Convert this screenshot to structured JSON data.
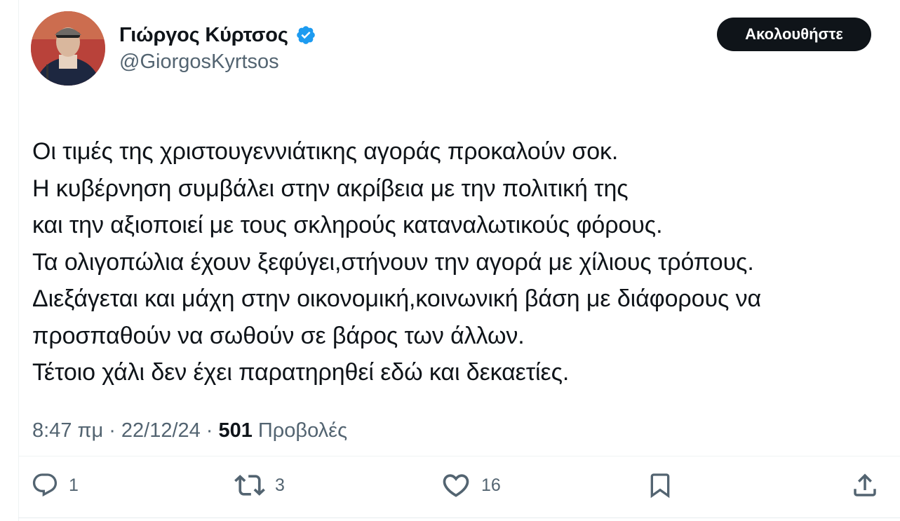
{
  "author": {
    "display_name": "Γιώργος Κύρτσος",
    "handle": "@GiorgosKyrtsos",
    "verified_icon": "verified-badge-icon",
    "verified_color": "#1d9bf0"
  },
  "follow_button": {
    "label": "Ακολουθήστε"
  },
  "tweet": {
    "lines": [
      "Οι τιμές της χριστουγεννιάτικης αγοράς προκαλούν σοκ.",
      "Η κυβέρνηση συμβάλει στην ακρίβεια με την πολιτική της",
      "και την αξιοποιεί με τους σκληρούς καταναλωτικούς φόρους.",
      "Τα ολιγοπώλια έχουν ξεφύγει,στήνουν την αγορά με χίλιους τρόπους.",
      "Διεξάγεται και μάχη στην οικονομική,κοινωνική βάση με διάφορους να",
      "προσπαθούν να σωθούν σε βάρος των άλλων.",
      "Τέτοιο χάλι δεν έχει παρατηρηθεί εδώ και δεκαετίες."
    ]
  },
  "meta": {
    "time": "8:47 πμ",
    "separator": "·",
    "date": "22/12/24",
    "views_count": "501",
    "views_label": "Προβολές"
  },
  "actions": {
    "reply": {
      "icon": "reply-icon",
      "count": "1"
    },
    "repost": {
      "icon": "repost-icon",
      "count": "3"
    },
    "like": {
      "icon": "heart-icon",
      "count": "16"
    },
    "bookmark": {
      "icon": "bookmark-icon"
    },
    "share": {
      "icon": "share-icon"
    }
  },
  "colors": {
    "text": "#0f1419",
    "secondary": "#536471",
    "button_bg": "#0f1419",
    "button_text": "#ffffff"
  }
}
